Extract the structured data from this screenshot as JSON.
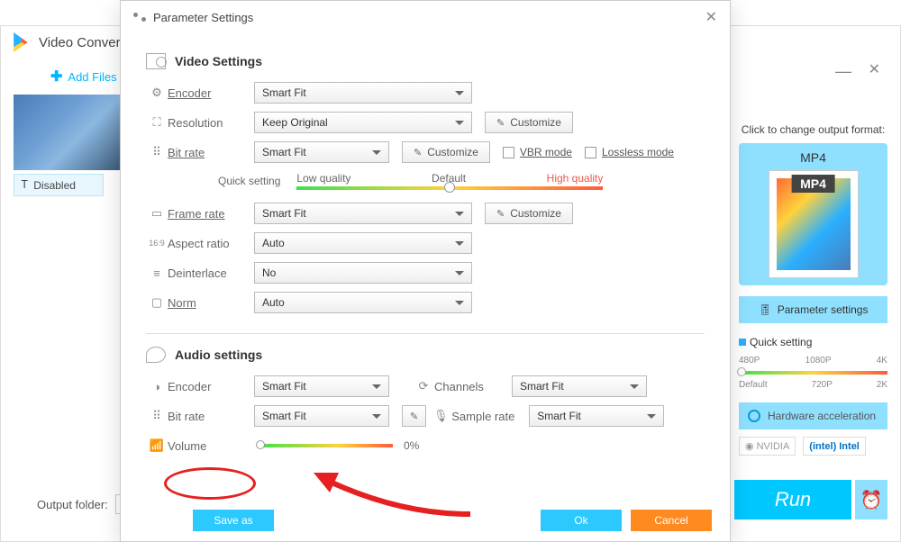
{
  "main": {
    "title": "Video Conver",
    "add_files": "Add Files",
    "disabled_tag": "Disabled",
    "output_label": "Output folder:",
    "run": "Run"
  },
  "right": {
    "change": "Click to change output format:",
    "format": "MP4",
    "mp4_badge": "MP4",
    "param_btn": "Parameter settings",
    "quick": "Quick setting",
    "marks_top": [
      "480P",
      "1080P",
      "4K"
    ],
    "marks_bottom": [
      "Default",
      "720P",
      "2K"
    ],
    "hw": "Hardware acceleration",
    "nvidia": "NVIDIA",
    "intel": "Intel"
  },
  "dlg": {
    "title": "Parameter Settings",
    "video_section": "Video Settings",
    "audio_section": "Audio settings",
    "labels": {
      "encoder": "Encoder",
      "resolution": "Resolution",
      "bitrate": "Bit rate",
      "quick_setting": "Quick setting",
      "framerate": "Frame rate",
      "aspect": "Aspect ratio",
      "deinterlace": "Deinterlace",
      "norm": "Norm",
      "channels": "Channels",
      "samplerate": "Sample rate",
      "volume": "Volume"
    },
    "values": {
      "encoder": "Smart Fit",
      "resolution": "Keep Original",
      "bitrate": "Smart Fit",
      "framerate": "Smart Fit",
      "aspect": "Auto",
      "deinterlace": "No",
      "norm": "Auto",
      "a_encoder": "Smart Fit",
      "a_bitrate": "Smart Fit",
      "channels": "Smart Fit",
      "samplerate": "Smart Fit",
      "volume_pct": "0%"
    },
    "buttons": {
      "customize": "Customize",
      "vbr": "VBR mode",
      "lossless": "Lossless mode",
      "save_as": "Save as",
      "ok": "Ok",
      "cancel": "Cancel"
    },
    "slider": {
      "low": "Low quality",
      "default": "Default",
      "high": "High quality"
    }
  }
}
